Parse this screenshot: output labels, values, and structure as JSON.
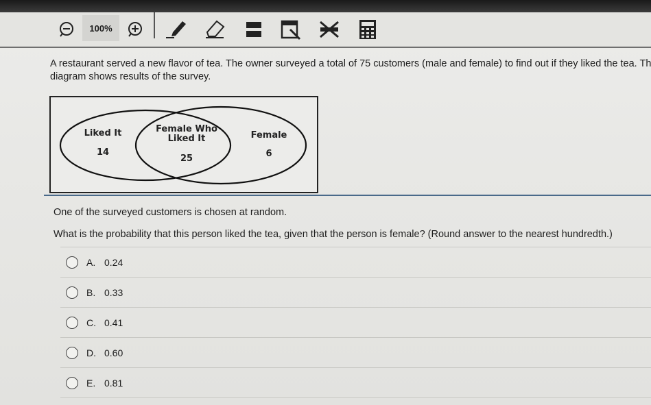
{
  "toolbar": {
    "zoom_label": "100%"
  },
  "problem": {
    "intro_line1": "A restaurant served a new flavor of tea. The owner surveyed a total of 75 customers (male and female) to find out if they liked the tea. Th",
    "intro_line2": "diagram shows results of the survey.",
    "prompt": "One of the surveyed customers is chosen at random.",
    "question": "What is the probability that this person liked the tea, given that the person is female? (Round answer to the nearest hundredth.)"
  },
  "venn": {
    "left_label": "Liked It",
    "left_value": "14",
    "center_label_line1": "Female Who",
    "center_label_line2": "Liked It",
    "center_value": "25",
    "right_label": "Female",
    "right_value": "6"
  },
  "options": [
    {
      "letter": "A.",
      "value": "0.24"
    },
    {
      "letter": "B.",
      "value": "0.33"
    },
    {
      "letter": "C.",
      "value": "0.41"
    },
    {
      "letter": "D.",
      "value": "0.60"
    },
    {
      "letter": "E.",
      "value": "0.81"
    }
  ],
  "icons": [
    "zoom-out-icon",
    "zoom-in-icon",
    "pen-icon",
    "eraser-icon",
    "highlighter-icon",
    "notepad-icon",
    "cross-out-icon",
    "calculator-icon"
  ]
}
